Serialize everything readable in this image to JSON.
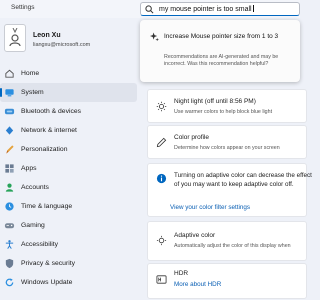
{
  "window": {
    "title": "Settings"
  },
  "user": {
    "name": "Leon Xu",
    "email": "liangxu@microsoft.com"
  },
  "nav": {
    "items": [
      {
        "label": "Home",
        "icon": "home-icon"
      },
      {
        "label": "System",
        "icon": "system-icon",
        "active": true
      },
      {
        "label": "Bluetooth & devices",
        "icon": "bluetooth-icon"
      },
      {
        "label": "Network & internet",
        "icon": "network-icon"
      },
      {
        "label": "Personalization",
        "icon": "brush-icon"
      },
      {
        "label": "Apps",
        "icon": "apps-icon"
      },
      {
        "label": "Accounts",
        "icon": "accounts-icon"
      },
      {
        "label": "Time & language",
        "icon": "time-icon"
      },
      {
        "label": "Gaming",
        "icon": "gaming-icon"
      },
      {
        "label": "Accessibility",
        "icon": "accessibility-icon"
      },
      {
        "label": "Privacy & security",
        "icon": "shield-icon"
      },
      {
        "label": "Windows Update",
        "icon": "update-icon"
      }
    ]
  },
  "search": {
    "value": "my mouse pointer is too small"
  },
  "suggestion": {
    "title": "Increase Mouse pointer size from 1 to 3",
    "note": "Recommendations are AI-generated and may be incorrect. Was this recommendation helpful?"
  },
  "main": {
    "night_light": {
      "title": "Night light (off until 8:56 PM)",
      "desc": "Use warmer colors to help block blue light"
    },
    "color_profile": {
      "title": "Color profile",
      "desc": "Determine how colors appear on your screen"
    },
    "info": {
      "text": "Turning on adaptive color can decrease the effect of you may want to keep adaptive color off.",
      "link": "View your color filter settings"
    },
    "adaptive": {
      "title": "Adaptive color",
      "desc": "Automatically adjust the color of this display when"
    },
    "hdr": {
      "title": "HDR",
      "link": "More about HDR"
    }
  },
  "colors": {
    "accent": "#0067c0",
    "background": "#eef1f8"
  }
}
